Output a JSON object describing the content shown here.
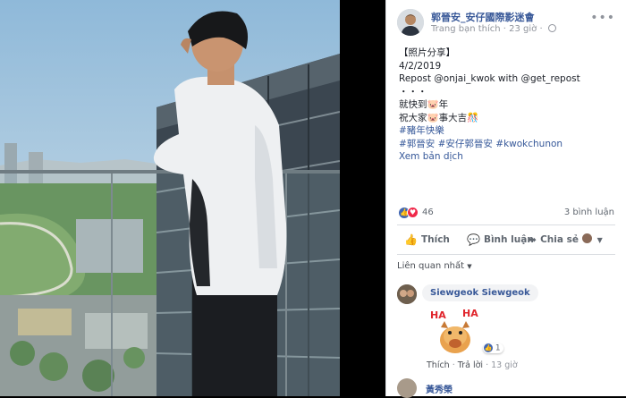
{
  "post": {
    "page_name": "郭晉安_安仔國際影迷會",
    "meta_label": "Trang bạn thích",
    "time_ago": "23 giờ",
    "lines": [
      "【照片分享】",
      "4/2/2019",
      "Repost @onjai_kwok with @get_repost",
      "・・・",
      "就快到🐷年",
      "祝大家🐷事大吉🎊"
    ],
    "hashtags_line1": "#豬年快樂",
    "hashtags_line2": "#郭晉安 #安仔郭晉安 #kwokchunon",
    "see_translation": "Xem bản dịch"
  },
  "stats": {
    "reaction_count": "46",
    "comment_count": "3 bình luận"
  },
  "actions": {
    "like": "Thích",
    "comment": "Bình luận",
    "share": "Chia sẻ"
  },
  "related_label": "Liên quan nhất",
  "comment1": {
    "author": "Siewgeok Siewgeok",
    "reaction_count": "1",
    "like": "Thích",
    "reply": "Trả lời",
    "time": "13 giờ"
  },
  "comment2": {
    "author": "黃秀榮"
  },
  "colors": {
    "link": "#385898",
    "like_blue": "#4267b2",
    "love_red": "#f0284a"
  }
}
